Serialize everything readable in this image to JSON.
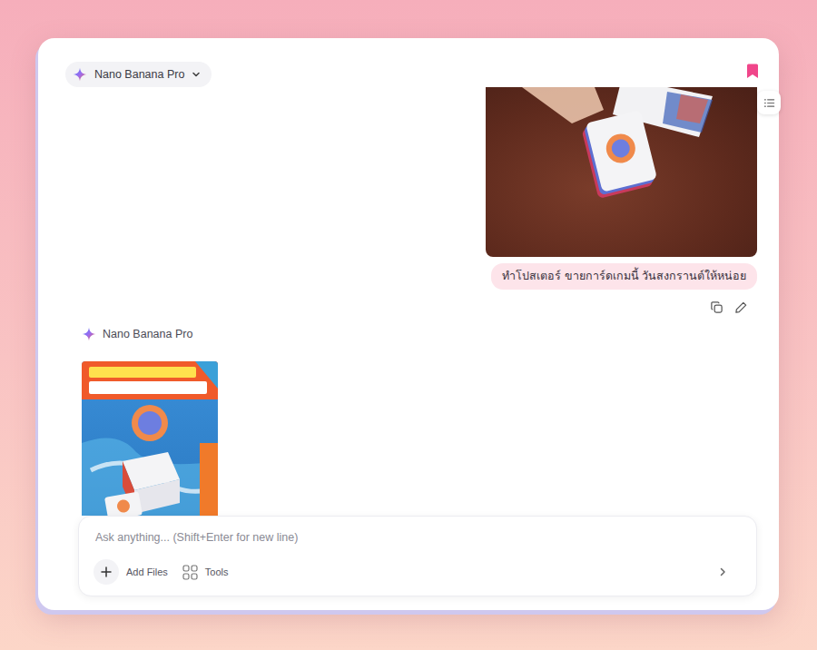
{
  "header": {
    "model": "Nano Banana Pro"
  },
  "user_message": {
    "text": "ทำโปสเตอร์ ขายการ์ดเกมนี้ วันสงกรานต์ให้หน่อย"
  },
  "assistant_message": {
    "name": "Nano Banana Pro"
  },
  "composer": {
    "placeholder": "Ask anything... (Shift+Enter for new line)",
    "add_files": "Add Files",
    "tools": "Tools"
  }
}
